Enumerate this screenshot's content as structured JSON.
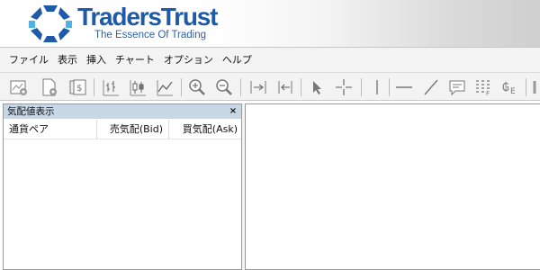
{
  "brand": {
    "name": "TradersTrust",
    "tagline": "The Essence Of Trading",
    "colors": {
      "primary": "#1e5aa8",
      "accent": "#4fb3e8"
    }
  },
  "menu": {
    "items": [
      {
        "label": "ファイル"
      },
      {
        "label": "表示"
      },
      {
        "label": "挿入"
      },
      {
        "label": "チャート"
      },
      {
        "label": "オプション"
      },
      {
        "label": "ヘルプ"
      }
    ]
  },
  "toolbar": {
    "buttons": [
      "new-chart-icon",
      "profiles-icon",
      "market-watch-icon",
      "bar-chart-icon",
      "candlestick-chart-icon",
      "line-chart-icon",
      "zoom-in-icon",
      "zoom-out-icon",
      "chart-shift-icon",
      "auto-scroll-icon",
      "cursor-icon",
      "crosshair-icon",
      "vertical-line-icon",
      "horizontal-line-icon",
      "trend-line-icon",
      "text-comment-icon",
      "fibonacci-icon",
      "periodicity-icon"
    ]
  },
  "market_watch": {
    "title": "気配値表示",
    "close_glyph": "×",
    "columns": {
      "pair": "通貨ペア",
      "bid": "売気配(Bid)",
      "ask": "買気配(Ask)"
    },
    "rows": []
  }
}
